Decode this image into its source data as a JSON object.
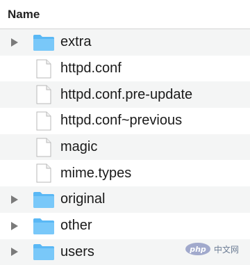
{
  "header": {
    "column_name": "Name"
  },
  "rows": [
    {
      "name": "extra",
      "type": "folder",
      "expandable": true,
      "alt": true
    },
    {
      "name": "httpd.conf",
      "type": "file",
      "expandable": false,
      "alt": false
    },
    {
      "name": "httpd.conf.pre-update",
      "type": "file",
      "expandable": false,
      "alt": true
    },
    {
      "name": "httpd.conf~previous",
      "type": "file",
      "expandable": false,
      "alt": false
    },
    {
      "name": "magic",
      "type": "file",
      "expandable": false,
      "alt": true
    },
    {
      "name": "mime.types",
      "type": "file",
      "expandable": false,
      "alt": false
    },
    {
      "name": "original",
      "type": "folder",
      "expandable": true,
      "alt": true
    },
    {
      "name": "other",
      "type": "folder",
      "expandable": true,
      "alt": false
    },
    {
      "name": "users",
      "type": "folder",
      "expandable": true,
      "alt": true
    }
  ],
  "watermark": {
    "logo": "php",
    "text": "中文网"
  },
  "colors": {
    "folder": "#5ab8f5",
    "folder_tab": "#79c8f9",
    "alt_row": "#f4f5f5",
    "disclosure": "#7a7a7a"
  }
}
